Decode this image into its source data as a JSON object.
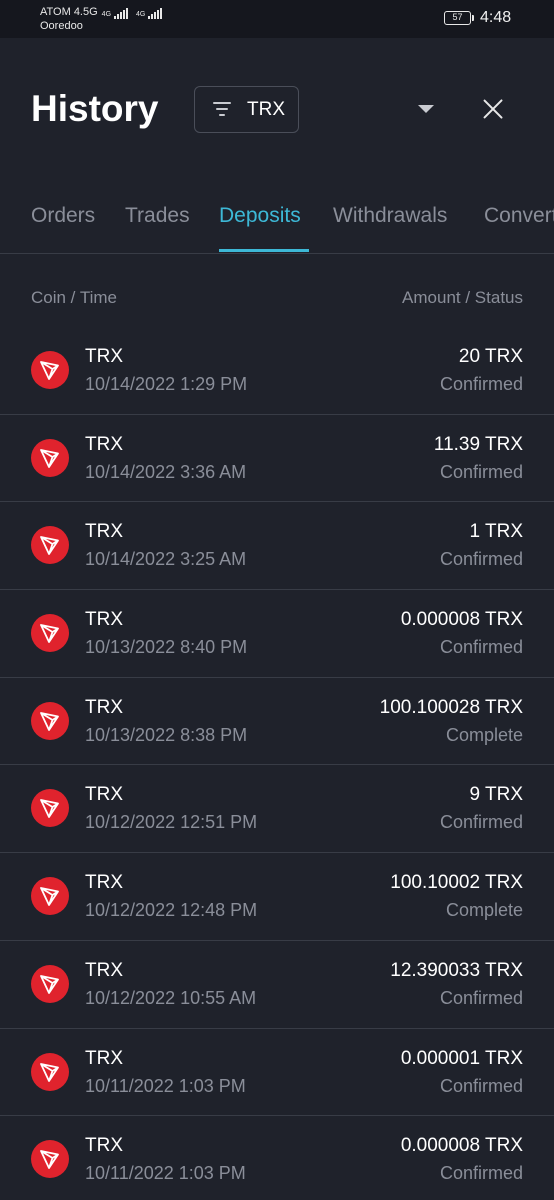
{
  "status_bar": {
    "carrier_primary": "ATOM 4.5G",
    "carrier_secondary": "Ooredoo",
    "net_type_1": "4G",
    "net_type_2": "4G",
    "battery": "57",
    "time": "4:48"
  },
  "header": {
    "title": "History",
    "filter_label": "TRX",
    "filter_icon": "filter-icon",
    "dropdown_icon": "chevron-down-icon",
    "close_icon": "close-icon"
  },
  "tabs": [
    {
      "label": "Orders",
      "active": false
    },
    {
      "label": "Trades",
      "active": false
    },
    {
      "label": "Deposits",
      "active": true
    },
    {
      "label": "Withdrawals",
      "active": false
    },
    {
      "label": "Convert",
      "active": false
    }
  ],
  "columns": {
    "left": "Coin / Time",
    "right": "Amount / Status"
  },
  "rows": [
    {
      "coin": "TRX",
      "time": "10/14/2022 1:29 PM",
      "amount": "20 TRX",
      "status": "Confirmed"
    },
    {
      "coin": "TRX",
      "time": "10/14/2022 3:36 AM",
      "amount": "11.39 TRX",
      "status": "Confirmed"
    },
    {
      "coin": "TRX",
      "time": "10/14/2022 3:25 AM",
      "amount": "1 TRX",
      "status": "Confirmed"
    },
    {
      "coin": "TRX",
      "time": "10/13/2022 8:40 PM",
      "amount": "0.000008 TRX",
      "status": "Confirmed"
    },
    {
      "coin": "TRX",
      "time": "10/13/2022 8:38 PM",
      "amount": "100.100028 TRX",
      "status": "Complete"
    },
    {
      "coin": "TRX",
      "time": "10/12/2022 12:51 PM",
      "amount": "9 TRX",
      "status": "Confirmed"
    },
    {
      "coin": "TRX",
      "time": "10/12/2022 12:48 PM",
      "amount": "100.10002 TRX",
      "status": "Complete"
    },
    {
      "coin": "TRX",
      "time": "10/12/2022 10:55 AM",
      "amount": "12.390033 TRX",
      "status": "Confirmed"
    },
    {
      "coin": "TRX",
      "time": "10/11/2022 1:03 PM",
      "amount": "0.000001 TRX",
      "status": "Confirmed"
    },
    {
      "coin": "TRX",
      "time": "10/11/2022 1:03 PM",
      "amount": "0.000008 TRX",
      "status": "Confirmed"
    }
  ],
  "colors": {
    "background": "#1f222b",
    "accent": "#3db8d6",
    "coin_red": "#e0232d",
    "muted_text": "#8a8e99"
  }
}
